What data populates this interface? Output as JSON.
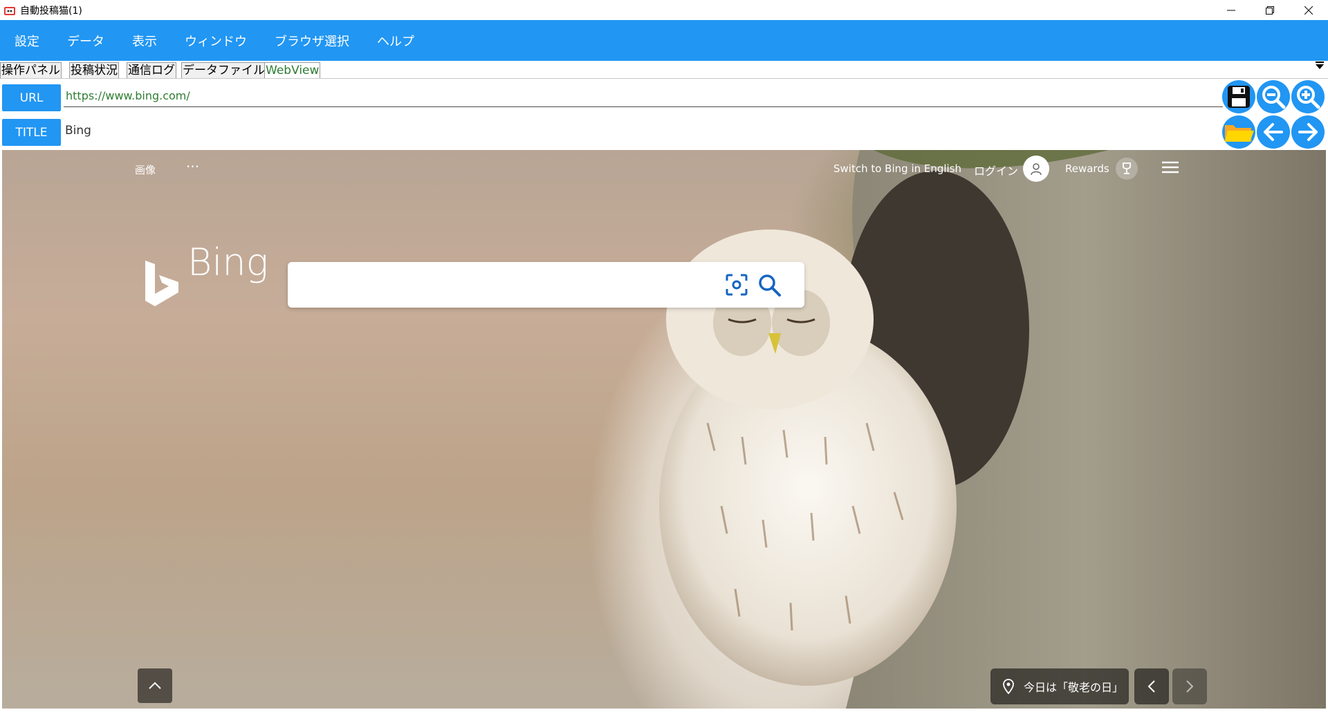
{
  "window": {
    "title": "自動投稿猫(1)"
  },
  "menu": [
    "設定",
    "データ",
    "表示",
    "ウィンドウ",
    "ブラウザ選択",
    "ヘルプ"
  ],
  "tabs": [
    "操作パネル",
    "投稿状況",
    "通信ログ",
    "データファイル",
    "WebView"
  ],
  "active_tab": "WebView",
  "address": {
    "url_label": "URL",
    "url_value": "https://www.bing.com/",
    "title_label": "TITLE",
    "title_value": "Bing"
  },
  "bing": {
    "nav_images": "画像",
    "nav_more": "···",
    "switch_lang": "Switch to Bing in English",
    "login": "ログイン",
    "rewards": "Rewards",
    "logo": "Bing",
    "search_placeholder": "",
    "location_text": "今日は「敬老の日」"
  },
  "icons": [
    "save-icon",
    "zoom-out-icon",
    "zoom-in-icon",
    "folder-icon",
    "back-icon",
    "forward-icon"
  ],
  "colors": {
    "accent": "#2196f3",
    "active_tab_text": "#2e7d32",
    "save_button": "#111111",
    "folder": "#ffd600"
  }
}
